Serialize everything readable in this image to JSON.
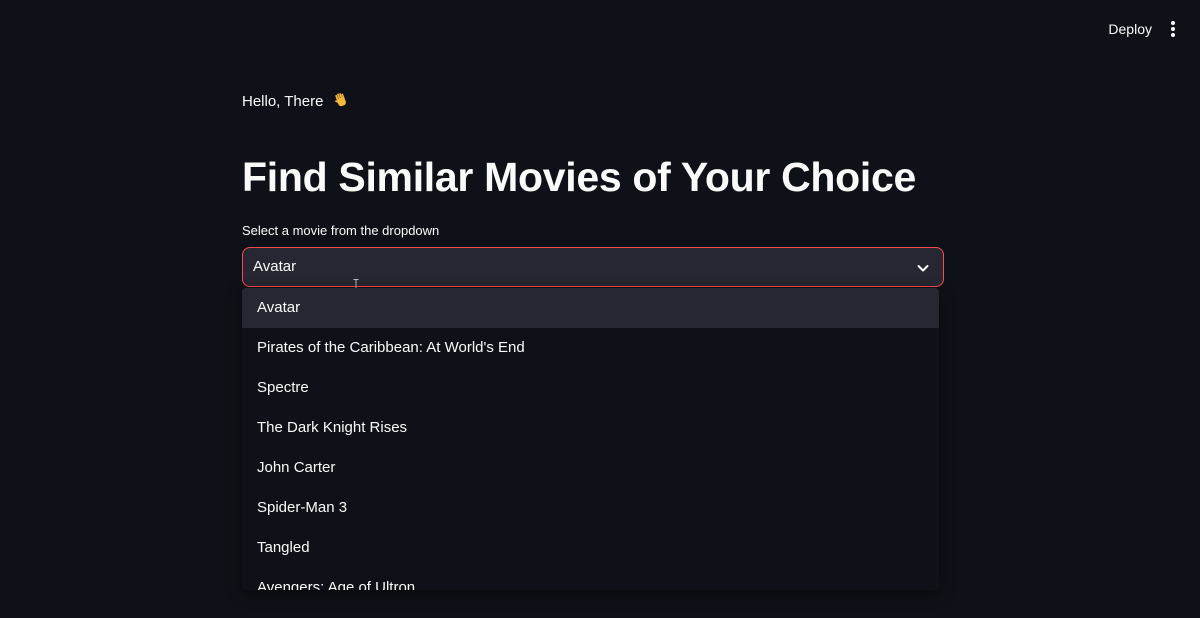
{
  "header": {
    "deploy_label": "Deploy",
    "menu_icon": "more-vertical-icon"
  },
  "main": {
    "greeting": "Hello, There",
    "greeting_icon": "waving-hand-icon",
    "title": "Find Similar Movies of Your Choice",
    "select_label": "Select a movie from the dropdown",
    "selected_value": "Avatar",
    "dropdown_icon": "chevron-down-icon"
  },
  "dropdown": {
    "options": [
      "Avatar",
      "Pirates of the Caribbean: At World's End",
      "Spectre",
      "The Dark Knight Rises",
      "John Carter",
      "Spider-Man 3",
      "Tangled",
      "Avengers: Age of Ultron"
    ],
    "highlighted_index": 0
  },
  "colors": {
    "background": "#0e1117",
    "input_background": "#262730",
    "accent": "#ff4b4b",
    "text": "#fafafa"
  }
}
